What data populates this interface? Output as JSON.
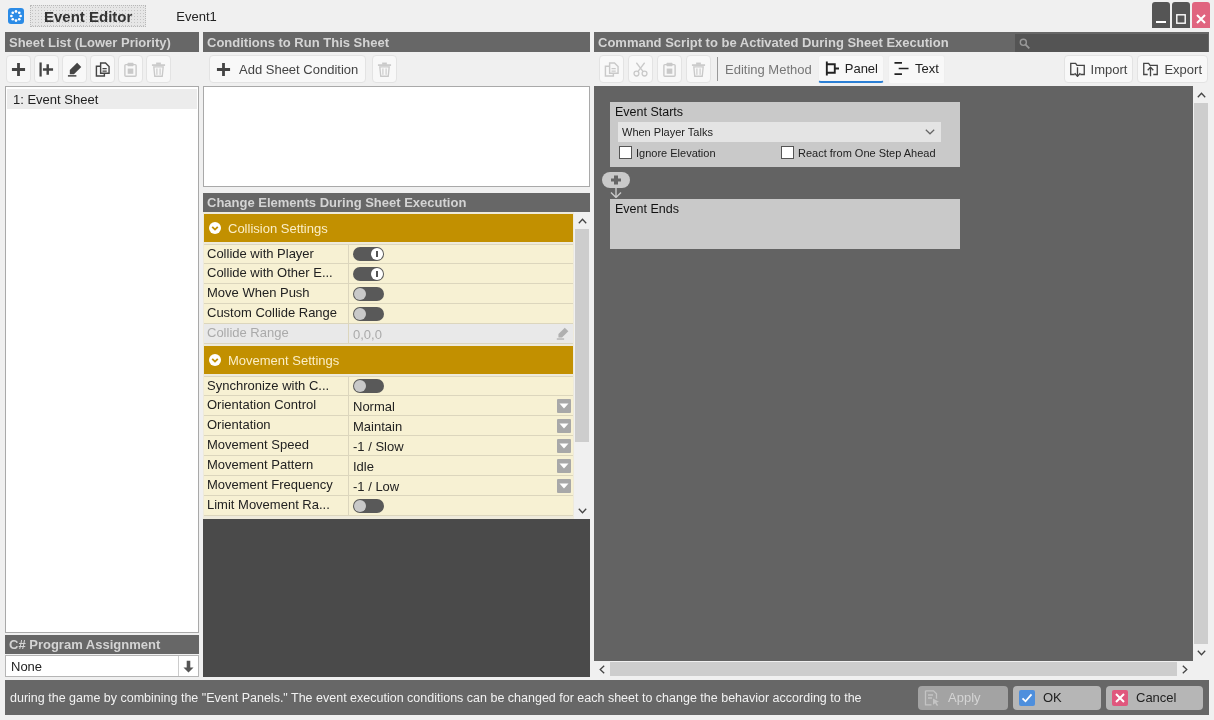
{
  "window": {
    "title": "Event Editor",
    "document": "Event1"
  },
  "sheet_list": {
    "header": "Sheet List (Lower Priority)",
    "toolbar": [
      {
        "kind": "add",
        "disabled": false
      },
      {
        "kind": "insert",
        "disabled": false
      },
      {
        "kind": "rename",
        "disabled": false
      },
      {
        "kind": "copy",
        "disabled": false
      },
      {
        "kind": "paste",
        "disabled": true
      },
      {
        "kind": "delete",
        "disabled": true
      }
    ],
    "items": [
      {
        "label": "1: Event Sheet",
        "selected": true
      }
    ]
  },
  "program": {
    "header": "C# Program Assignment",
    "value": "None"
  },
  "conditions": {
    "header": "Conditions to Run This Sheet",
    "toolbar": [
      {
        "kind": "add",
        "label": "Add Sheet Condition",
        "disabled": false
      },
      {
        "kind": "delete",
        "disabled": true
      }
    ]
  },
  "change_elements": {
    "header": "Change Elements During Sheet Execution",
    "groups": [
      {
        "title": "Collision Settings",
        "expanded": true,
        "rows": [
          {
            "label": "Collide with Player",
            "kind": "toggle",
            "on": true,
            "disabled": false
          },
          {
            "label": "Collide with Other E...",
            "kind": "toggle",
            "on": true,
            "disabled": false
          },
          {
            "label": "Move When Push",
            "kind": "toggle",
            "on": false,
            "disabled": false
          },
          {
            "label": "Custom Collide Range",
            "kind": "toggle",
            "on": false,
            "disabled": false
          },
          {
            "label": "Collide Range",
            "kind": "text",
            "value": "0,0,0",
            "disabled": true
          }
        ]
      },
      {
        "title": "Movement Settings",
        "expanded": true,
        "rows": [
          {
            "label": "Synchronize with C...",
            "kind": "toggle",
            "on": false,
            "disabled": false
          },
          {
            "label": "Orientation Control",
            "kind": "dropdown",
            "value": "Normal",
            "disabled": false
          },
          {
            "label": "Orientation",
            "kind": "dropdown",
            "value": "Maintain",
            "disabled": false
          },
          {
            "label": "Movement Speed",
            "kind": "dropdown",
            "value": "-1 / Slow",
            "disabled": false
          },
          {
            "label": "Movement Pattern",
            "kind": "dropdown",
            "value": "Idle",
            "disabled": false
          },
          {
            "label": "Movement Frequency",
            "kind": "dropdown",
            "value": "-1 / Low",
            "disabled": false
          },
          {
            "label": "Limit Movement Ra...",
            "kind": "toggle",
            "on": false,
            "disabled": false
          }
        ]
      }
    ]
  },
  "script": {
    "header": "Command Script to be Activated During Sheet Execution",
    "toolbar": [
      {
        "kind": "copy",
        "disabled": true
      },
      {
        "kind": "cut",
        "disabled": true
      },
      {
        "kind": "paste",
        "disabled": true
      },
      {
        "kind": "delete",
        "disabled": true
      }
    ],
    "editing_method": "Editing Method",
    "tabs": [
      {
        "kind": "panel",
        "label": "Panel",
        "selected": true
      },
      {
        "kind": "text",
        "label": "Text",
        "selected": false
      }
    ],
    "actions": [
      {
        "kind": "import",
        "label": "Import"
      },
      {
        "kind": "export",
        "label": "Export"
      }
    ],
    "events": [
      {
        "kind": "start",
        "title": "Event Starts",
        "trigger": "When Player Talks",
        "options": [
          {
            "label": "Ignore Elevation",
            "checked": false
          },
          {
            "label": "React from One Step Ahead",
            "checked": false
          }
        ]
      },
      {
        "kind": "end",
        "title": "Event Ends"
      }
    ]
  },
  "status_bar": {
    "message": "during the game by combining the \"Event Panels.\" The event execution conditions can be changed for each sheet to change the behavior according to the",
    "buttons": [
      {
        "kind": "apply",
        "label": "Apply",
        "disabled": true
      },
      {
        "kind": "ok",
        "label": "OK",
        "disabled": false
      },
      {
        "kind": "cancel",
        "label": "Cancel",
        "disabled": false
      }
    ]
  }
}
